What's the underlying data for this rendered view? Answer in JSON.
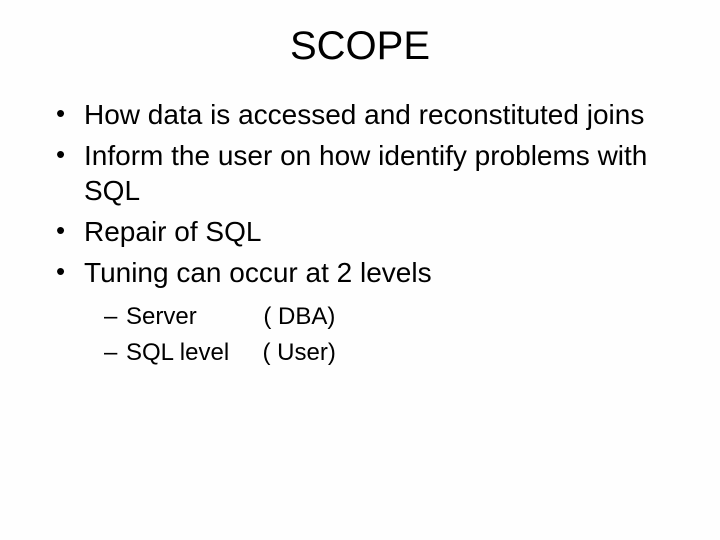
{
  "title": "SCOPE",
  "bullets": [
    "How data is accessed and reconstituted joins",
    "Inform the user on how identify problems with SQL",
    "Repair of SQL",
    "Tuning can occur at 2 levels"
  ],
  "sub": [
    "Server          ( DBA)",
    "SQL level     ( User)"
  ]
}
